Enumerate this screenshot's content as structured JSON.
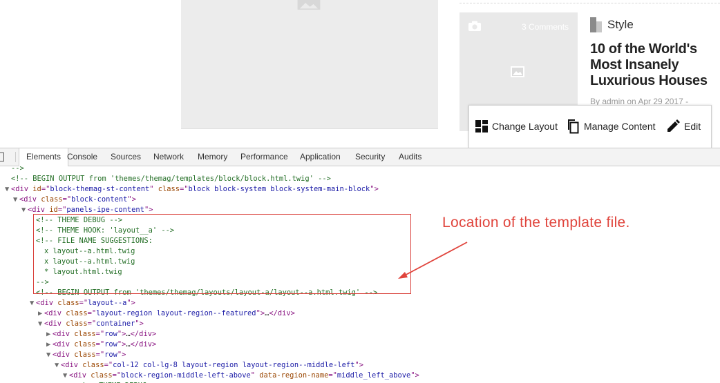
{
  "page": {
    "card": {
      "comments": "3 Comments",
      "category": "Style",
      "title": "10 of the World's Most Insanely Luxurious Houses",
      "byline": "By admin on Apr 29 2017 -"
    },
    "ipe_toolbar": {
      "change_layout": "Change Layout",
      "manage_content": "Manage Content",
      "edit": "Edit"
    }
  },
  "devtools": {
    "tabs": [
      "Elements",
      "Console",
      "Sources",
      "Network",
      "Memory",
      "Performance",
      "Application",
      "Security",
      "Audits"
    ],
    "active_tab": "Elements",
    "lines": [
      {
        "indent": 0,
        "tri": "",
        "kind": "comment",
        "text": "-->"
      },
      {
        "indent": 0,
        "tri": "",
        "kind": "comment",
        "text": "<!-- BEGIN OUTPUT from 'themes/themag/templates/block/block.html.twig' -->"
      },
      {
        "indent": 0,
        "tri": "▼",
        "kind": "tag",
        "tag": "div",
        "attrs": [
          [
            "id",
            "block-themag-st-content"
          ],
          [
            "class",
            "block block-system block-system-main-block"
          ]
        ],
        "close": ""
      },
      {
        "indent": 1,
        "tri": "▼",
        "kind": "tag",
        "tag": "div",
        "attrs": [
          [
            "class",
            "block-content"
          ]
        ],
        "close": ""
      },
      {
        "indent": 2,
        "tri": "▼",
        "kind": "tag",
        "tag": "div",
        "attrs": [
          [
            "id",
            "panels-ipe-content"
          ]
        ],
        "close": ""
      },
      {
        "indent": 3,
        "tri": "",
        "kind": "comment",
        "text": "<!-- THEME DEBUG -->"
      },
      {
        "indent": 3,
        "tri": "",
        "kind": "comment",
        "text": "<!-- THEME HOOK: 'layout__a' -->"
      },
      {
        "indent": 3,
        "tri": "",
        "kind": "comment",
        "text": "<!-- FILE NAME SUGGESTIONS:"
      },
      {
        "indent": 4,
        "tri": "",
        "kind": "comment",
        "text": "x layout--a.html.twig"
      },
      {
        "indent": 4,
        "tri": "",
        "kind": "comment",
        "text": "x layout--a.html.twig"
      },
      {
        "indent": 4,
        "tri": "",
        "kind": "comment",
        "text": "* layout.html.twig"
      },
      {
        "indent": 3,
        "tri": "",
        "kind": "comment",
        "text": "-->"
      },
      {
        "indent": 3,
        "tri": "",
        "kind": "comment",
        "text": "<!-- BEGIN OUTPUT from 'themes/themag/layouts/layout-a/layout--a.html.twig' -->"
      },
      {
        "indent": 3,
        "tri": "▼",
        "kind": "tag",
        "tag": "div",
        "attrs": [
          [
            "class",
            "layout--a"
          ]
        ],
        "close": ""
      },
      {
        "indent": 4,
        "tri": "▶",
        "kind": "tag",
        "tag": "div",
        "attrs": [
          [
            "class",
            "layout-region layout-region--featured"
          ]
        ],
        "close": "…</div>"
      },
      {
        "indent": 4,
        "tri": "▼",
        "kind": "tag",
        "tag": "div",
        "attrs": [
          [
            "class",
            "container"
          ]
        ],
        "close": ""
      },
      {
        "indent": 5,
        "tri": "▶",
        "kind": "tag",
        "tag": "div",
        "attrs": [
          [
            "class",
            "row"
          ]
        ],
        "close": "…</div>"
      },
      {
        "indent": 5,
        "tri": "▶",
        "kind": "tag",
        "tag": "div",
        "attrs": [
          [
            "class",
            "row"
          ]
        ],
        "close": "…</div>"
      },
      {
        "indent": 5,
        "tri": "▼",
        "kind": "tag",
        "tag": "div",
        "attrs": [
          [
            "class",
            "row"
          ]
        ],
        "close": ""
      },
      {
        "indent": 6,
        "tri": "▼",
        "kind": "tag",
        "tag": "div",
        "attrs": [
          [
            "class",
            "col-12 col-lg-8 layout-region layout-region--middle-left"
          ]
        ],
        "close": ""
      },
      {
        "indent": 7,
        "tri": "▼",
        "kind": "tag",
        "tag": "div",
        "attrs": [
          [
            "class",
            "block-region-middle-left-above"
          ],
          [
            "data-region-name",
            "middle_left_above"
          ]
        ],
        "close": ""
      },
      {
        "indent": 8,
        "tri": "",
        "kind": "comment",
        "text": "<!-- THEME DEBUG -->"
      }
    ]
  },
  "annotation": {
    "callout_text": "Location of the template file.",
    "color": "#e0443c"
  }
}
